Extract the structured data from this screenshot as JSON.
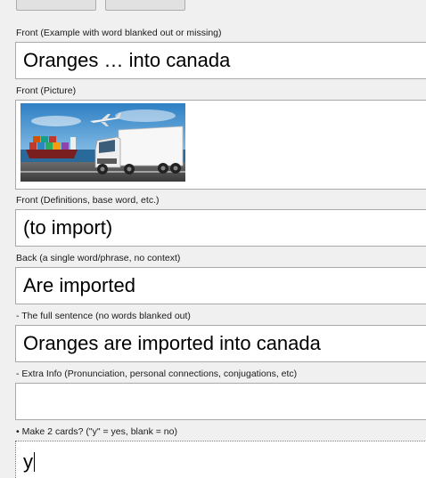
{
  "fields": [
    {
      "label": "Front (Example with word blanked out or missing)",
      "value": "Oranges … into canada"
    },
    {
      "label": "Front (Picture)",
      "value": ""
    },
    {
      "label": "Front (Definitions, base word, etc.)",
      "value": "(to import)"
    },
    {
      "label": "Back (a single word/phrase, no context)",
      "value": "Are imported"
    },
    {
      "label": "- The full sentence (no words blanked out)",
      "value": "Oranges are imported into canada"
    },
    {
      "label": "- Extra Info (Pronunciation, personal connections, conjugations, etc)",
      "value": ""
    },
    {
      "label": "• Make 2 cards? (\"y\" = yes, blank = no)",
      "value": "y"
    }
  ],
  "picture": {
    "icon": "cargo-transport-image"
  }
}
